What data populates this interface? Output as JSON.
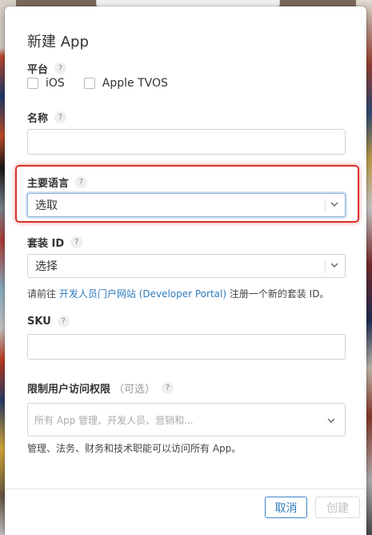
{
  "dialog": {
    "title": "新建 App",
    "help_glyph": "?",
    "platform": {
      "label": "平台",
      "options": [
        {
          "label": "iOS",
          "checked": false
        },
        {
          "label": "Apple TVOS",
          "checked": false
        }
      ]
    },
    "name": {
      "label": "名称",
      "value": ""
    },
    "primary_language": {
      "label": "主要语言",
      "selected": "选取"
    },
    "bundle_id": {
      "label": "套装 ID",
      "selected": "选择",
      "note_prefix": "请前往",
      "note_link": "开发人员门户网站 (Developer Portal)",
      "note_suffix": "注册一个新的套装 ID。"
    },
    "sku": {
      "label": "SKU",
      "value": ""
    },
    "user_access": {
      "label": "限制用户访问权限",
      "optional": "（可选）",
      "placeholder": "所有 App 管理、开发人员、营销和...",
      "note": "管理、法务、财务和技术职能可以访问所有 App。"
    },
    "buttons": {
      "cancel": "取消",
      "create": "创建"
    }
  },
  "colors": {
    "link": "#2f7bbd",
    "highlight": "#d9342a",
    "disabled_text": "#c2c2c2"
  }
}
